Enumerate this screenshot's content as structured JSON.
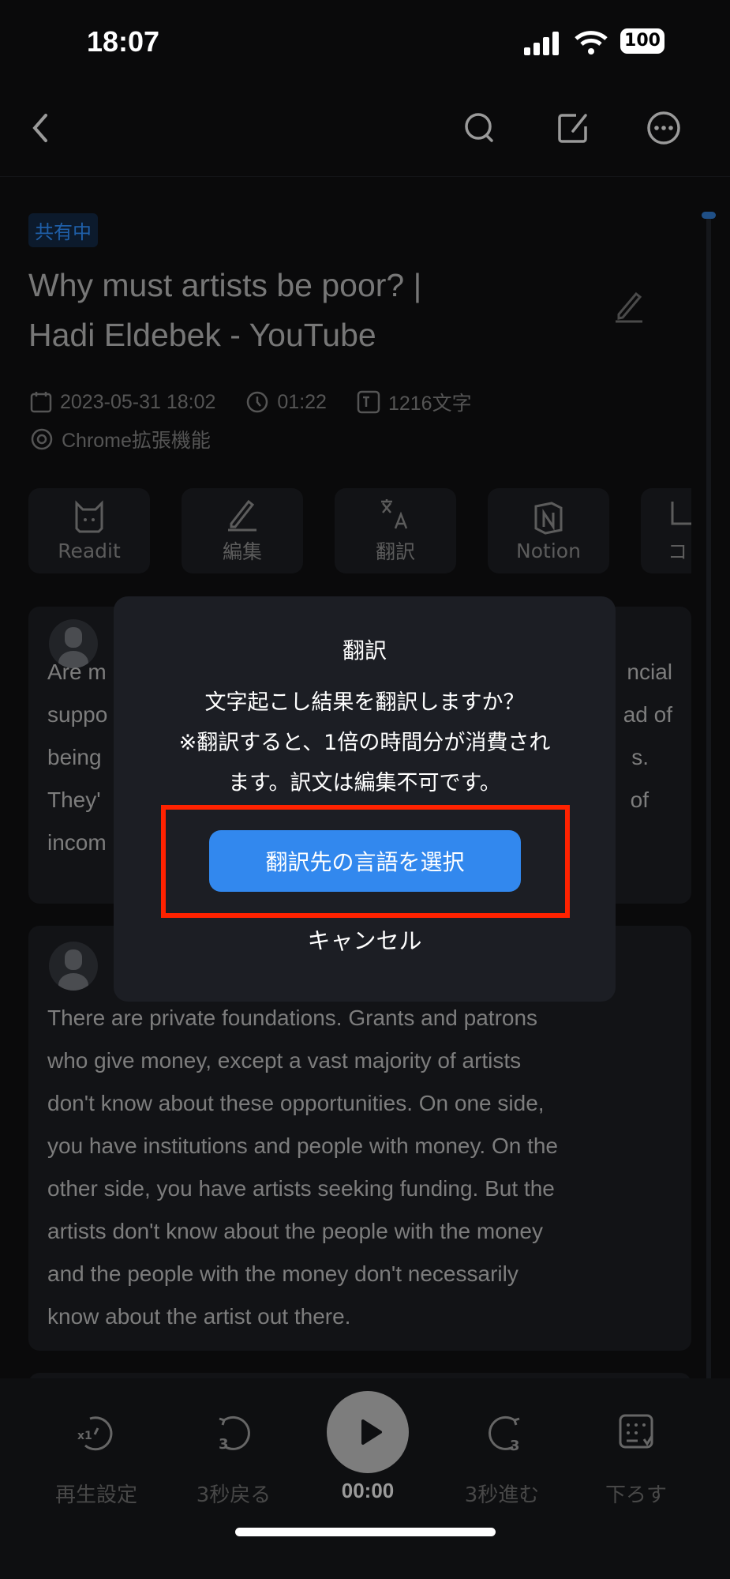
{
  "status_bar": {
    "time": "18:07",
    "battery": "100"
  },
  "nav": {
    "back_icon": "chevron-left-icon",
    "search_icon": "search-icon",
    "edit_icon": "edit-icon",
    "more_icon": "more-icon"
  },
  "doc": {
    "badge": "共有中",
    "title_line1": "Why must artists be poor? |",
    "title_line2": "Hadi Eldebek - YouTube",
    "date": "2023-05-31 18:02",
    "duration": "01:22",
    "char_count": "1216文字",
    "source": "Chrome拡張機能"
  },
  "actions": [
    {
      "label": "Readit",
      "icon": "cat-icon"
    },
    {
      "label": "編集",
      "icon": "pencil-icon"
    },
    {
      "label": "翻訳",
      "icon": "translate-icon"
    },
    {
      "label": "Notion",
      "icon": "notion-icon"
    },
    {
      "label": "コ",
      "icon": "copy-icon"
    }
  ],
  "cards": [
    {
      "lines": [
        [
          "Are m",
          "ncial"
        ],
        [
          "suppo",
          "ad of"
        ],
        [
          "being",
          "s."
        ],
        [
          "They'",
          "of"
        ],
        [
          "incom",
          ""
        ]
      ]
    },
    {
      "lines": [
        "There are private foundations. Grants and patrons",
        "who give money, except a vast majority of artists",
        "don't know about these opportunities. On one side,",
        "you have institutions and people with money. On the",
        "other side, you have artists seeking funding. But the",
        "artists don't know about the people with the money",
        "and the people with the money don't necessarily",
        "know about the artist out there."
      ]
    }
  ],
  "player": {
    "speed": "再生設定",
    "back": "3秒戻る",
    "time": "00:00",
    "forward": "3秒進む",
    "down": "下ろす",
    "speed_badge": "x1",
    "skip": "3"
  },
  "dialog": {
    "title": "翻訳",
    "body_line1": "文字起こし結果を翻訳しますか？",
    "body_line2": "※翻訳すると、1倍の時間分が消費され",
    "body_line3": "ます。訳文は編集不可です。",
    "primary": "翻訳先の言語を選択",
    "cancel": "キャンセル",
    "highlight_color": "#ff2200",
    "primary_color": "#3288ee"
  }
}
